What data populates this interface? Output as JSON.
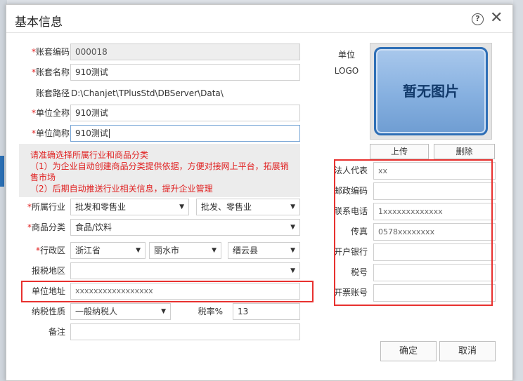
{
  "dialog": {
    "title": "基本信息",
    "help_glyph": "?",
    "close_glyph": "✕"
  },
  "form": {
    "account_code": {
      "label": "账套编码",
      "value": "000018"
    },
    "account_name": {
      "label": "账套名称",
      "value": "910测试"
    },
    "account_path": {
      "label": "账套路径",
      "value": "D:\\Chanjet\\TPlusStd\\DBServer\\Data\\"
    },
    "unit_full_name": {
      "label": "单位全称",
      "value": "910测试"
    },
    "unit_short_name": {
      "label": "单位简称",
      "value": "910测试"
    },
    "required_mark": "*",
    "notice": [
      "请准确选择所属行业和商品分类",
      "（1）为企业自动创建商品分类提供依据，方便对接网上平台，拓展销售市场",
      "（2）后期自动推送行业相关信息，提升企业管理"
    ],
    "industry": {
      "label": "所属行业",
      "value": "批发和零售业",
      "sub_value": "批发、零售业"
    },
    "goods_category": {
      "label": "商品分类",
      "value": "食品/饮料"
    },
    "region": {
      "label": "行政区",
      "province": "浙江省",
      "city": "丽水市",
      "county": "缙云县"
    },
    "tax_region": {
      "label": "报税地区",
      "value": ""
    },
    "unit_address": {
      "label": "单位地址",
      "value": "xxxxxxxxxxxxxxxxx"
    },
    "taxpayer_type": {
      "label": "纳税性质",
      "value": "一般纳税人"
    },
    "tax_rate": {
      "label": "税率%",
      "value": "13"
    },
    "remark": {
      "label": "备注",
      "value": ""
    }
  },
  "logo": {
    "label_line1": "单位",
    "label_line2": "LOGO",
    "placeholder_text": "暂无图片",
    "upload_label": "上传",
    "delete_label": "删除"
  },
  "right_fields": {
    "legal_rep": {
      "label": "法人代表",
      "value": "xx"
    },
    "postal_code": {
      "label": "邮政编码",
      "value": ""
    },
    "phone": {
      "label": "联系电话",
      "value": "1xxxxxxxxxxxxx"
    },
    "fax": {
      "label": "传真",
      "value": "0578xxxxxxxx"
    },
    "bank": {
      "label": "开户银行",
      "value": ""
    },
    "tax_number": {
      "label": "税号",
      "value": ""
    },
    "invoice_account": {
      "label": "开票账号",
      "value": ""
    }
  },
  "footer": {
    "confirm_label": "确定",
    "cancel_label": "取消"
  },
  "colors": {
    "required": "#e02020",
    "highlight_box": "#e8312f",
    "logo_border": "#2f6fb6"
  },
  "icons": [
    "help-icon",
    "close-icon",
    "dropdown-arrow-icon"
  ],
  "dropdown_glyph": "▼"
}
